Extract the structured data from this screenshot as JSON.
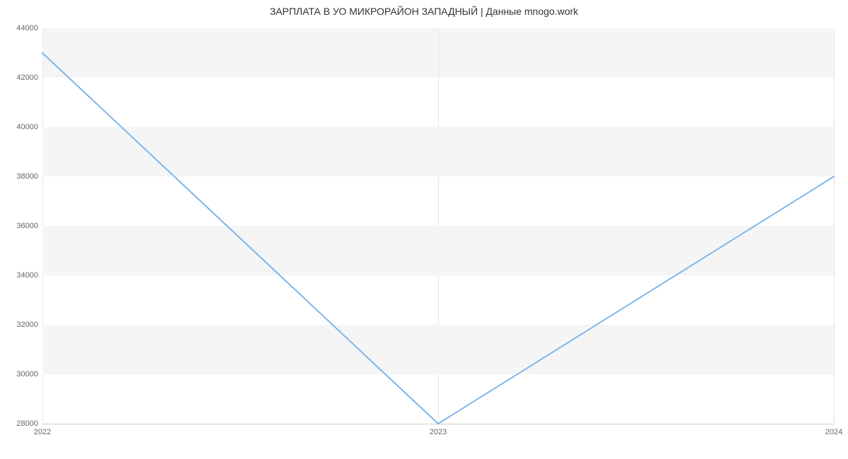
{
  "chart_data": {
    "type": "line",
    "title": "ЗАРПЛАТА В УО МИКРОРАЙОН ЗАПАДНЫЙ | Данные mnogo.work",
    "xlabel": "",
    "ylabel": "",
    "x_categories": [
      "2022",
      "2023",
      "2024"
    ],
    "series": [
      {
        "name": "salary",
        "values": [
          43000,
          28000,
          38000
        ],
        "color": "#7cb5ec"
      }
    ],
    "ylim": [
      28000,
      44000
    ],
    "y_ticks": [
      28000,
      30000,
      32000,
      34000,
      36000,
      38000,
      40000,
      42000,
      44000
    ],
    "y_tick_labels": [
      "28000",
      "30000",
      "32000",
      "34000",
      "36000",
      "38000",
      "40000",
      "42000",
      "44000"
    ],
    "grid": true
  }
}
